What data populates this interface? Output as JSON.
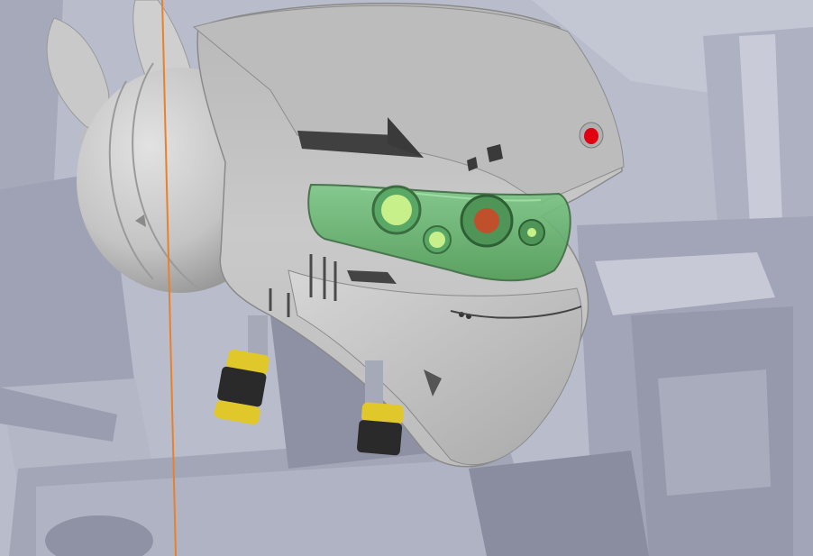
{
  "scene": {
    "caption": "",
    "colors": {
      "background": "#b9bccb",
      "shade_light": "#c7c9d6",
      "shade_mid": "#a9acbd",
      "shade_dark": "#8d90a4",
      "helmet": "#cfcfcf",
      "helmet_dark": "#a8a8a8",
      "visor_glass": "#6fbf6f",
      "lens_light": "#c8f08a",
      "lens_red": "#c0502c",
      "indicator_red": "#e00010",
      "guide_line": "#e8812b",
      "cable_yellow": "#e0c82a",
      "cable_black": "#2a2a2a"
    }
  }
}
